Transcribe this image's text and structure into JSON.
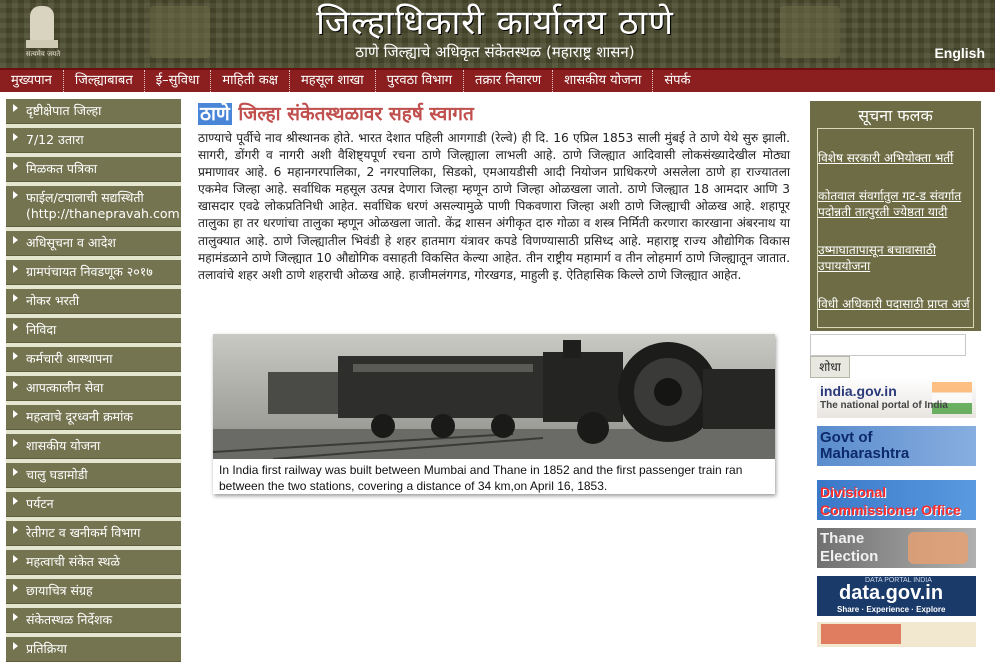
{
  "header": {
    "emblem_motto": "सत्यमेव जयते",
    "title": "जिल्हाधिकारी कार्यालय ठाणे",
    "subtitle": "ठाणे जिल्ह्याचे अधिकृत संकेतस्थळ (महाराष्ट्र शासन)",
    "language_link": "English"
  },
  "nav": {
    "items": [
      "मुख्यपान",
      "जिल्ह्याबाबत",
      "ई–सुविधा",
      "माहिती कक्ष",
      "महसूल शाखा",
      "पुरवठा विभाग",
      "तक्रार निवारण",
      "शासकीय योजना",
      "संपर्क"
    ]
  },
  "left_menu": {
    "items": [
      "दृष्टीक्षेपात जिल्हा",
      "7/12 उतारा",
      "मिळकत पत्रिका",
      "फाईल/टपालाची सद्यस्थिती (http://thanepravah.com)",
      "अधिसूचना व आदेश",
      "ग्रामपंचायत निवडणूक २०१७",
      "नोकर भरती",
      "निविदा",
      "कर्मचारी आस्थापना",
      "आपत्कालीन सेवा",
      "महत्वाचे दूरध्वनी क्रमांक",
      "शासकीय योजना",
      "चालु घडामोडी",
      "पर्यटन",
      "रेतीगट व खनीकर्म विभाग",
      "महत्वाची संकेत स्थळे",
      "छायाचित्र संग्रह",
      "संकेतस्थळ  निर्देशक",
      "प्रतिक्रिया"
    ]
  },
  "main": {
    "heading_highlight": "ठाणे",
    "heading_rest": " जिल्हा संकेतस्थळावर सहर्ष स्वागत",
    "intro": "ठाण्याचे पूर्वीचे नाव श्रीस्थानक होते. भारत देशात पहिली आगगाडी (रेल्वे) ही दि. 16 एप्रिल 1853 साली मुंबई ते ठाणे येथे सुरु झाली. सागरी, डोंगरी व नागरी अशी वैशिष्ट्यपूर्ण रचना ठाणे जिल्ह्याला लाभली आहे. ठाणे जिल्ह्यात आदिवासी लोकसंख्यादेखील मोठ्या प्रमाणावर आहे. 6 महानगरपालिका, 2 नगरपालिका, सिडको, एमआयडीसी आदी नियोजन प्राधिकरणे  असलेला ठाणे हा राज्यातला एकमेव जिल्हा आहे. सर्वाधिक महसूल उत्पन्न देणारा जिल्हा म्हणून ठाणे जिल्हा ओळखला जातो. ठाणे जिल्ह्यात 18 आमदार आणि 3 खासदार एवढे लोकप्रतिनिधी आहेत. सर्वाधिक धरणं असल्यामुळे पाणी पिकवणारा जिल्हा अशी ठाणे जिल्ह्याची ओळख आहे. शहापूर तालुका हा तर धरणांचा तालुका म्हणून ओळखला जातो. केंद्र शासन अंगीकृत दारु गोळा व शस्त्र निर्मिती करणारा कारखाना अंबरनाथ या तालुक्यात आहे. ठाणे जिल्ह्यातील भिवंडी हे शहर हातमाग यंत्रावर कपडे विणण्यासाठी प्रसिध्द आहे. महाराष्ट्र राज्य औद्योगिक विकास महामंडळाने ठाणे जिल्ह्यात 10 औद्योगिक वसाहती विकसित केल्या आहेत. तीन राष्ट्रीय महामार्ग व तीन लोहमार्ग ठाणे जिल्ह्यातून जातात. तलावांचे शहर अशी ठाणे शहराची ओळख आहे. हाजीमलंगगड, गोरखगड, माहुली इ. ऐतिहासिक किल्ले ठाणे जिल्ह्यात आहेत.",
    "photo_caption": "In India first railway was built between Mumbai and Thane in 1852 and the first passenger train ran between the two stations, covering a distance of  34 km,on  April 16, 1853."
  },
  "notice_board": {
    "title": "सूचना फलक",
    "items": [
      "विशेष सरकारी अभियोक्ता भर्ती",
      "कोतवाल संवर्गातुल गट-ड संवर्गात पदोन्नती तात्पुरती ज्येष्ठता यादी",
      "उष्माघातापासून बचावासाठी उपाययोजना",
      "विधी अधिकारी पदासाठी प्राप्त अर्ज"
    ]
  },
  "search": {
    "placeholder": "",
    "button_label": "शोधा"
  },
  "banners": {
    "india": {
      "line1": "india.gov.in",
      "line2": "The national portal of India"
    },
    "maharashtra": {
      "line1": "Govt of",
      "line2": "Maharashtra"
    },
    "divcom": {
      "line1": "Divisional",
      "line2": "Commissioner Office"
    },
    "election": {
      "line1": "Thane",
      "line2": "Election"
    },
    "datagov": {
      "line0": "DATA PORTAL INDIA",
      "line1": "data.gov.in",
      "line2": "Share  ·  Experience  ·  Explore"
    }
  },
  "colors": {
    "header_bg": "#4a4a2e",
    "nav_bg": "#8b1e1e",
    "menu_item_bg": "#747450",
    "heading_accent": "#c0504d",
    "notice_bg": "#6d6c44"
  },
  "icons": {
    "emblem": "state-emblem-icon",
    "menu_arrow": "triangle-right-icon"
  }
}
